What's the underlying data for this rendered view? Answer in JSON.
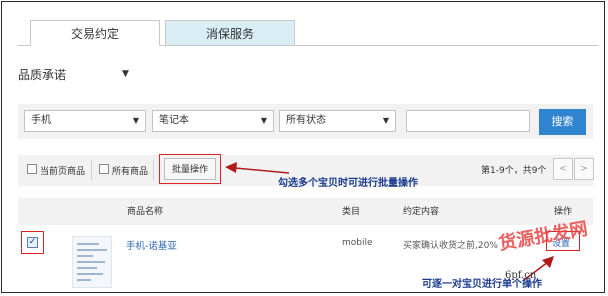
{
  "tabs": [
    {
      "label": "交易约定"
    },
    {
      "label": "消保服务"
    }
  ],
  "quality_dropdown": {
    "label": "品质承诺"
  },
  "filters": {
    "select1": "手机",
    "select2": "笔记本",
    "select3": "所有状态",
    "search_value": "",
    "search_button": "搜索"
  },
  "toolbar": {
    "current_page_label": "当前页商品",
    "all_items_label": "所有商品",
    "batch_button": "批量操作",
    "annotation": "勾选多个宝贝时可进行批量操作",
    "pager_text": "第1-9个，共9个",
    "prev": "<",
    "next": ">"
  },
  "table": {
    "headers": {
      "name": "商品名称",
      "category": "类目",
      "commitment": "约定内容",
      "action": "操作"
    },
    "rows": [
      {
        "checked": "✓",
        "name": "手机-诺基亚",
        "category": "mobile",
        "commitment": "买家确认收货之前,20%",
        "action": "设置"
      }
    ]
  },
  "annotation_row": "可逐一对宝贝进行单个操作",
  "watermark": {
    "main": "货源批发网",
    "sub": "6pf.cn"
  },
  "colors": {
    "accent": "#2f84cf",
    "annotation": "#1a3a8f",
    "highlight_box": "#d82626",
    "tab_inactive_bg": "#d9edf5"
  }
}
